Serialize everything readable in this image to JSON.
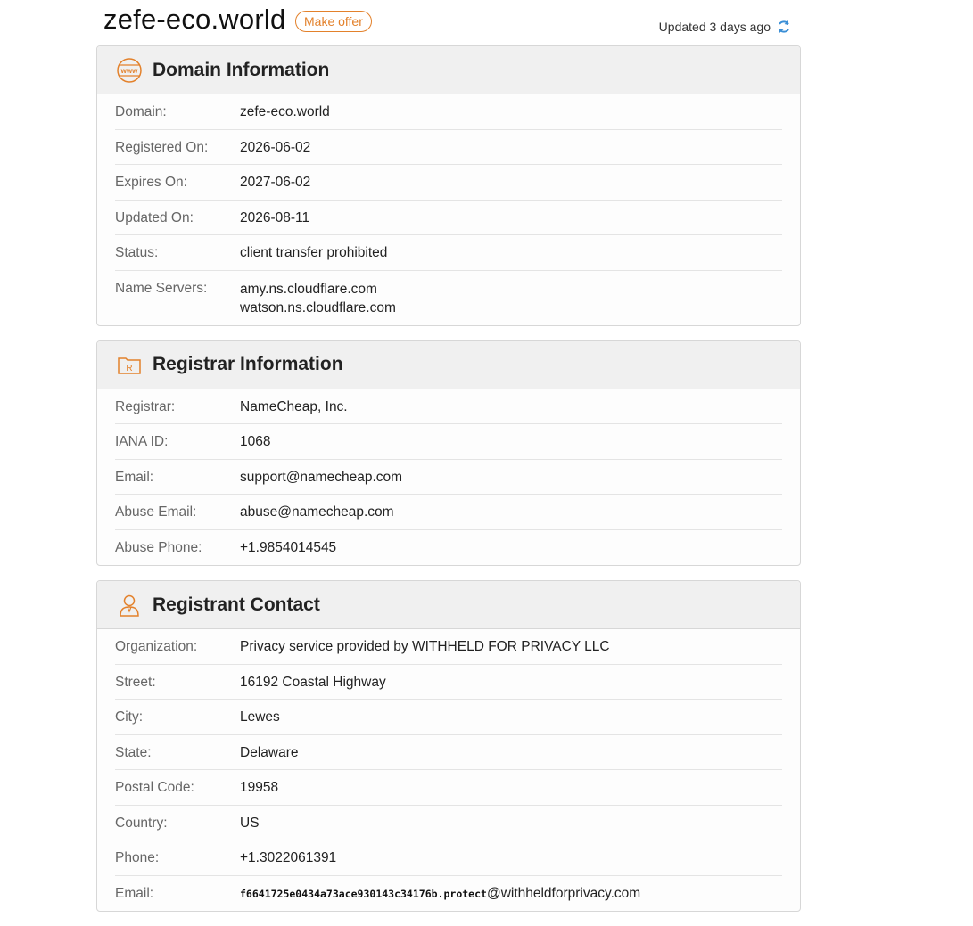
{
  "header": {
    "domain": "zefe-eco.world",
    "make_offer": "Make offer",
    "updated": "Updated 3 days ago"
  },
  "colors": {
    "accent": "#e3812b",
    "refresh": "#3b8fd6"
  },
  "domain_info": {
    "title": "Domain Information",
    "icon": "www-globe-icon",
    "rows": [
      {
        "k": "Domain:",
        "v": "zefe-eco.world"
      },
      {
        "k": "Registered On:",
        "v": "2026-06-02"
      },
      {
        "k": "Expires On:",
        "v": "2027-06-02"
      },
      {
        "k": "Updated On:",
        "v": "2026-08-11"
      },
      {
        "k": "Status:",
        "v": "client transfer prohibited"
      }
    ],
    "name_servers": {
      "k": "Name Servers:",
      "v1": "amy.ns.cloudflare.com",
      "v2": "watson.ns.cloudflare.com"
    }
  },
  "registrar_info": {
    "title": "Registrar Information",
    "icon": "registrar-folder-icon",
    "rows": [
      {
        "k": "Registrar:",
        "v": "NameCheap, Inc."
      },
      {
        "k": "IANA ID:",
        "v": "1068"
      },
      {
        "k": "Email:",
        "v": "support@namecheap.com"
      },
      {
        "k": "Abuse Email:",
        "v": "abuse@namecheap.com"
      },
      {
        "k": "Abuse Phone:",
        "v": "+1.9854014545"
      }
    ]
  },
  "registrant": {
    "title": "Registrant Contact",
    "icon": "person-icon",
    "rows": [
      {
        "k": "Organization:",
        "v": "Privacy service provided by WITHHELD FOR PRIVACY LLC"
      },
      {
        "k": "Street:",
        "v": "16192 Coastal Highway"
      },
      {
        "k": "City:",
        "v": "Lewes"
      },
      {
        "k": "State:",
        "v": "Delaware"
      },
      {
        "k": "Postal Code:",
        "v": "19958"
      },
      {
        "k": "Country:",
        "v": "US"
      },
      {
        "k": "Phone:",
        "v": "+1.3022061391"
      }
    ],
    "email": {
      "k": "Email:",
      "user": "f6641725e0434a73ace930143c34176b.protect",
      "domain": "@withheldforprivacy.com"
    }
  }
}
